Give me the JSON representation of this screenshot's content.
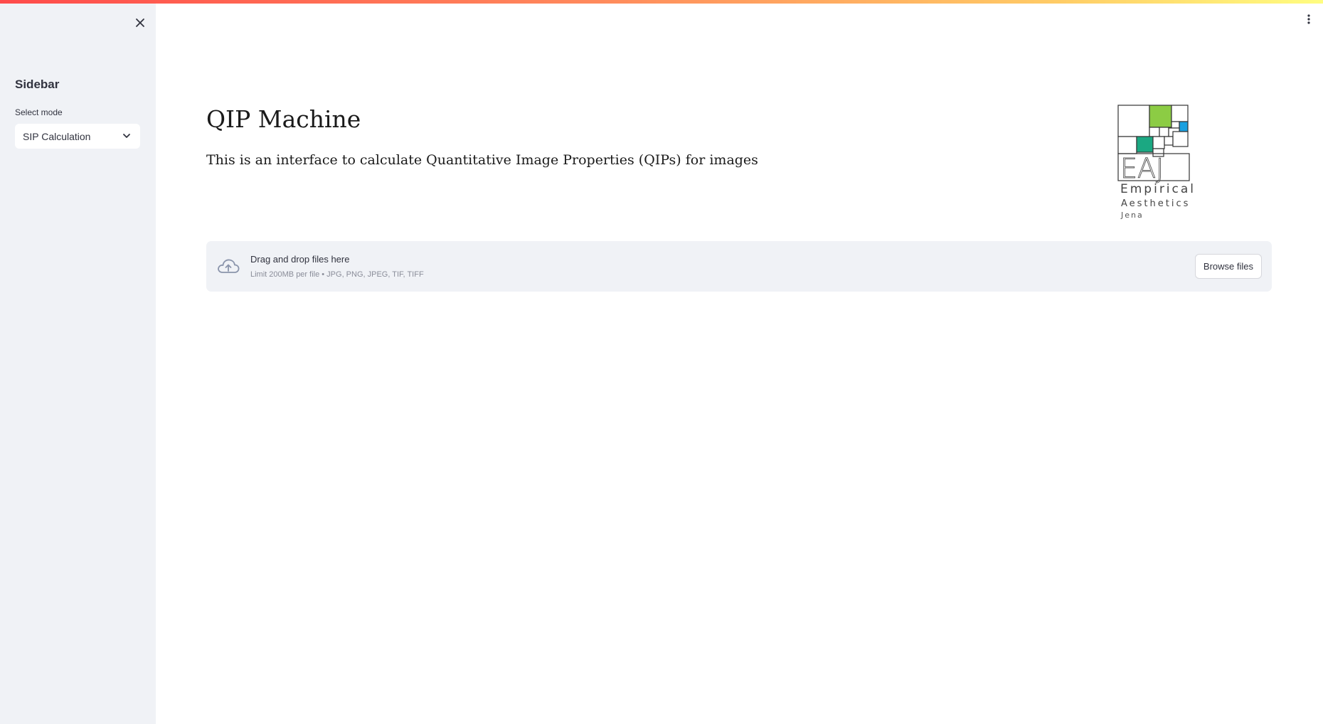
{
  "app": {
    "accent_gradient": [
      "#ff4b4b",
      "#ffcc66",
      "#fffd80"
    ]
  },
  "sidebar": {
    "title": "Sidebar",
    "close_icon": "close-icon",
    "select_label": "Select mode",
    "select_value": "SIP Calculation",
    "select_icon": "chevron-down-icon"
  },
  "header": {
    "menu_icon": "kebab-menu-icon"
  },
  "main": {
    "title": "QIP Machine",
    "description": "This is an interface to calculate Quantitative Image Properties (QIPs) for images",
    "logo": {
      "line1": "Empirical",
      "line2": "Aesthetics",
      "line3": "Jena",
      "letters": "EAJ",
      "colors": {
        "green": "#8ccc44",
        "blue": "#1aa0e0",
        "teal": "#1ba882"
      }
    },
    "uploader": {
      "icon": "cloud-upload-icon",
      "main_text": "Drag and drop files here",
      "sub_text": "Limit 200MB per file • JPG, PNG, JPEG, TIF, TIFF",
      "button_label": "Browse files"
    }
  }
}
